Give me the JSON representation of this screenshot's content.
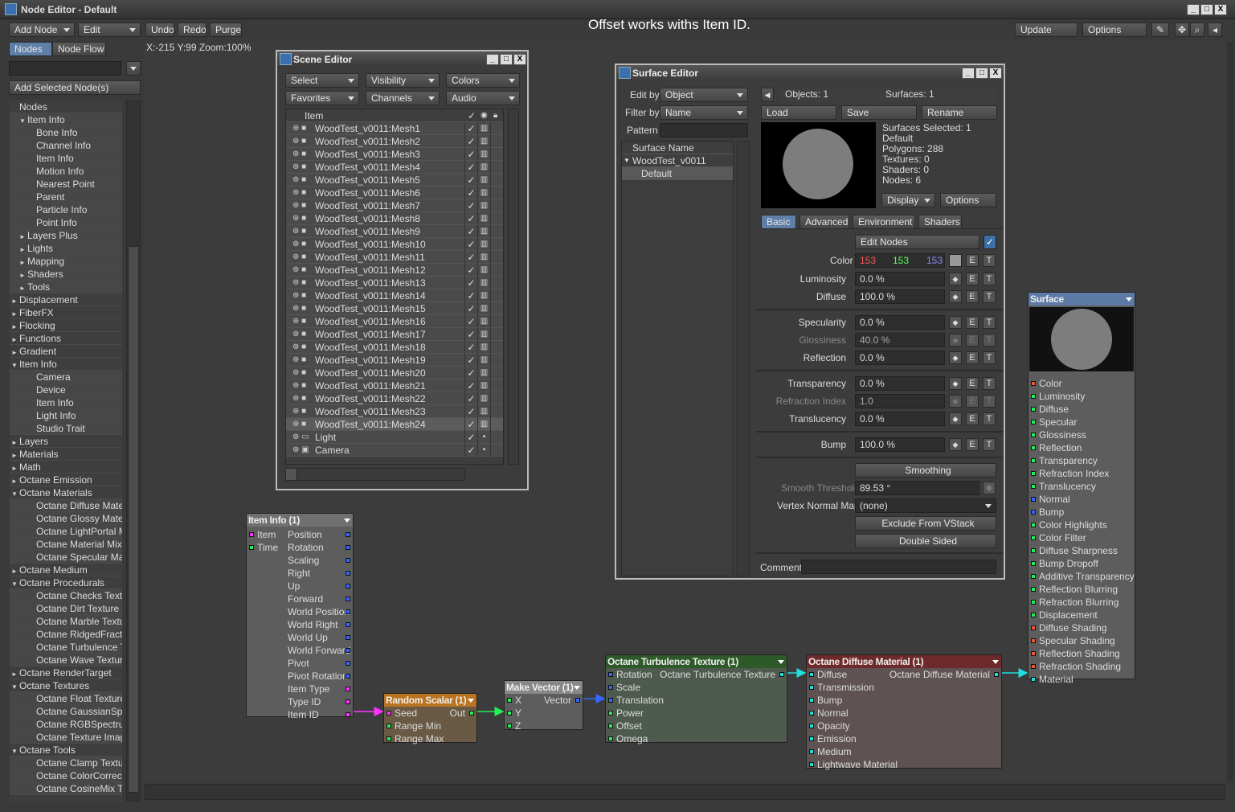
{
  "window": {
    "title": "Node Editor - Default",
    "min": "_",
    "max": "□",
    "close": "X"
  },
  "toolbar": {
    "add_node": "Add Node",
    "edit": "Edit",
    "undo": "Undo",
    "redo": "Redo",
    "purge": "Purge",
    "update": "Update",
    "options": "Options"
  },
  "overlay_text": "Offset works withs Item ID.",
  "tabs": {
    "nodes": "Nodes",
    "node_flow": "Node Flow"
  },
  "add_selected": "Add Selected Node(s)",
  "coords": "X:-215 Y:99 Zoom:100%",
  "sidebar": {
    "items": [
      {
        "label": "Nodes",
        "level": 0,
        "arrow": ""
      },
      {
        "label": "Item Info",
        "level": 1,
        "arrow": "▼"
      },
      {
        "label": "Bone Info",
        "level": 2,
        "arrow": ""
      },
      {
        "label": "Channel Info",
        "level": 2,
        "arrow": ""
      },
      {
        "label": "Item Info",
        "level": 2,
        "arrow": ""
      },
      {
        "label": "Motion Info",
        "level": 2,
        "arrow": ""
      },
      {
        "label": "Nearest Point",
        "level": 2,
        "arrow": ""
      },
      {
        "label": "Parent",
        "level": 2,
        "arrow": ""
      },
      {
        "label": "Particle Info",
        "level": 2,
        "arrow": ""
      },
      {
        "label": "Point Info",
        "level": 2,
        "arrow": ""
      },
      {
        "label": "Layers Plus",
        "level": 1,
        "arrow": "►"
      },
      {
        "label": "Lights",
        "level": 1,
        "arrow": "►"
      },
      {
        "label": "Mapping",
        "level": 1,
        "arrow": "►"
      },
      {
        "label": "Shaders",
        "level": 1,
        "arrow": "►"
      },
      {
        "label": "Tools",
        "level": 1,
        "arrow": "►"
      },
      {
        "label": "Displacement",
        "level": 0,
        "arrow": "►"
      },
      {
        "label": "FiberFX",
        "level": 0,
        "arrow": "►"
      },
      {
        "label": "Flocking",
        "level": 0,
        "arrow": "►"
      },
      {
        "label": "Functions",
        "level": 0,
        "arrow": "►"
      },
      {
        "label": "Gradient",
        "level": 0,
        "arrow": "►"
      },
      {
        "label": "Item Info",
        "level": 0,
        "arrow": "▼"
      },
      {
        "label": "Camera",
        "level": 2,
        "arrow": ""
      },
      {
        "label": "Device",
        "level": 2,
        "arrow": ""
      },
      {
        "label": "Item Info",
        "level": 2,
        "arrow": ""
      },
      {
        "label": "Light Info",
        "level": 2,
        "arrow": ""
      },
      {
        "label": "Studio Trait",
        "level": 2,
        "arrow": ""
      },
      {
        "label": "Layers",
        "level": 0,
        "arrow": "►"
      },
      {
        "label": "Materials",
        "level": 0,
        "arrow": "►"
      },
      {
        "label": "Math",
        "level": 0,
        "arrow": "►"
      },
      {
        "label": "Octane Emission",
        "level": 0,
        "arrow": "►"
      },
      {
        "label": "Octane Materials",
        "level": 0,
        "arrow": "▼"
      },
      {
        "label": "Octane Diffuse Material",
        "level": 2,
        "arrow": ""
      },
      {
        "label": "Octane Glossy Material",
        "level": 2,
        "arrow": ""
      },
      {
        "label": "Octane LightPortal Mate",
        "level": 2,
        "arrow": ""
      },
      {
        "label": "Octane Material Mixer",
        "level": 2,
        "arrow": ""
      },
      {
        "label": "Octane Specular Materia",
        "level": 2,
        "arrow": ""
      },
      {
        "label": "Octane Medium",
        "level": 0,
        "arrow": "►"
      },
      {
        "label": "Octane Procedurals",
        "level": 0,
        "arrow": "▼"
      },
      {
        "label": "Octane Checks Texture",
        "level": 2,
        "arrow": ""
      },
      {
        "label": "Octane Dirt Texture",
        "level": 2,
        "arrow": ""
      },
      {
        "label": "Octane Marble Texture",
        "level": 2,
        "arrow": ""
      },
      {
        "label": "Octane RidgedFractal Te",
        "level": 2,
        "arrow": ""
      },
      {
        "label": "Octane Turbulence Text",
        "level": 2,
        "arrow": ""
      },
      {
        "label": "Octane Wave Texture",
        "level": 2,
        "arrow": ""
      },
      {
        "label": "Octane RenderTarget",
        "level": 0,
        "arrow": "►"
      },
      {
        "label": "Octane Textures",
        "level": 0,
        "arrow": "▼"
      },
      {
        "label": "Octane Float Texture",
        "level": 2,
        "arrow": ""
      },
      {
        "label": "Octane GaussianSpectru",
        "level": 2,
        "arrow": ""
      },
      {
        "label": "Octane RGBSpectrum T",
        "level": 2,
        "arrow": ""
      },
      {
        "label": "Octane Texture Image",
        "level": 2,
        "arrow": ""
      },
      {
        "label": "Octane Tools",
        "level": 0,
        "arrow": "▼"
      },
      {
        "label": "Octane Clamp Texture",
        "level": 2,
        "arrow": ""
      },
      {
        "label": "Octane ColorCorrect Tex",
        "level": 2,
        "arrow": ""
      },
      {
        "label": "Octane CosineMix Textu",
        "level": 2,
        "arrow": ""
      }
    ]
  },
  "scene_editor": {
    "title": "Scene Editor",
    "select": "Select",
    "visibility": "Visibility",
    "colors": "Colors",
    "favorites": "Favorites",
    "channels": "Channels",
    "audio": "Audio",
    "col_item": "Item",
    "items": [
      "WoodTest_v0011:Mesh1",
      "WoodTest_v0011:Mesh2",
      "WoodTest_v0011:Mesh3",
      "WoodTest_v0011:Mesh4",
      "WoodTest_v0011:Mesh5",
      "WoodTest_v0011:Mesh6",
      "WoodTest_v0011:Mesh7",
      "WoodTest_v0011:Mesh8",
      "WoodTest_v0011:Mesh9",
      "WoodTest_v0011:Mesh10",
      "WoodTest_v0011:Mesh11",
      "WoodTest_v0011:Mesh12",
      "WoodTest_v0011:Mesh13",
      "WoodTest_v0011:Mesh14",
      "WoodTest_v0011:Mesh15",
      "WoodTest_v0011:Mesh16",
      "WoodTest_v0011:Mesh17",
      "WoodTest_v0011:Mesh18",
      "WoodTest_v0011:Mesh19",
      "WoodTest_v0011:Mesh20",
      "WoodTest_v0011:Mesh21",
      "WoodTest_v0011:Mesh22",
      "WoodTest_v0011:Mesh23",
      "WoodTest_v0011:Mesh24",
      "Light",
      "Camera"
    ]
  },
  "surface_editor": {
    "title": "Surface Editor",
    "edit_by_label": "Edit by",
    "edit_by": "Object",
    "filter_by_label": "Filter by",
    "filter_by": "Name",
    "pattern_label": "Pattern",
    "objects": "Objects: 1",
    "surfaces": "Surfaces: 1",
    "load": "Load",
    "save": "Save",
    "rename": "Rename",
    "col_surface": "Surface Name",
    "tree_obj": "WoodTest_v0011",
    "tree_surf": "Default",
    "info": [
      "Surfaces Selected: 1",
      "Default",
      "Polygons: 288",
      "Textures: 0",
      "Shaders: 0",
      "Nodes: 6"
    ],
    "display": "Display",
    "options": "Options",
    "tabs": [
      "Basic",
      "Advanced",
      "Environment",
      "Shaders"
    ],
    "edit_nodes": "Edit Nodes",
    "color_label": "Color",
    "color_r": "153",
    "color_g": "153",
    "color_b": "153",
    "props": [
      {
        "label": "Luminosity",
        "value": "0.0 %"
      },
      {
        "label": "Diffuse",
        "value": "100.0 %"
      },
      {
        "label": "Specularity",
        "value": "0.0 %"
      },
      {
        "label": "Glossiness",
        "value": "40.0 %"
      },
      {
        "label": "Reflection",
        "value": "0.0 %"
      },
      {
        "label": "Transparency",
        "value": "0.0 %"
      },
      {
        "label": "Refraction Index",
        "value": "1.0"
      },
      {
        "label": "Translucency",
        "value": "0.0 %"
      },
      {
        "label": "Bump",
        "value": "100.0 %"
      }
    ],
    "smoothing": "Smoothing",
    "smooth_threshold_label": "Smooth Threshold",
    "smooth_threshold": "89.53 °",
    "vertex_normal_label": "Vertex Normal Map",
    "vertex_normal": "(none)",
    "exclude": "Exclude From VStack",
    "double_sided": "Double Sided",
    "comment_label": "Comment",
    "e": "E",
    "t": "T"
  },
  "nodes": {
    "item_info": {
      "title": "Item Info (1)",
      "inputs": [
        "Item",
        "Time"
      ],
      "outputs": [
        "Position",
        "Rotation",
        "Scaling",
        "Right",
        "Up",
        "Forward",
        "World Position",
        "World Right",
        "World Up",
        "World Forward",
        "Pivot",
        "Pivot Rotation",
        "Item Type",
        "Type ID",
        "Item ID"
      ]
    },
    "random_scalar": {
      "title": "Random Scalar (1)",
      "inputs": [
        "Seed",
        "Range Min",
        "Range Max"
      ],
      "output": "Out"
    },
    "make_vector": {
      "title": "Make Vector (1)",
      "inputs": [
        "X",
        "Y",
        "Z"
      ],
      "output": "Vector"
    },
    "turbulence": {
      "title": "Octane Turbulence Texture (1)",
      "inputs": [
        "Rotation",
        "Scale",
        "Translation",
        "Power",
        "Offset",
        "Omega"
      ],
      "output": "Octane Turbulence Texture"
    },
    "diffuse": {
      "title": "Octane Diffuse Material (1)",
      "inputs": [
        "Diffuse",
        "Transmission",
        "Bump",
        "Normal",
        "Opacity",
        "Emission",
        "Medium",
        "Lightwave Material"
      ],
      "output": "Octane Diffuse Material"
    },
    "surface": {
      "title": "Surface",
      "inputs": [
        "Color",
        "Luminosity",
        "Diffuse",
        "Specular",
        "Glossiness",
        "Reflection",
        "Transparency",
        "Refraction Index",
        "Translucency",
        "Normal",
        "Bump",
        "Color Highlights",
        "Color Filter",
        "Diffuse Sharpness",
        "Bump Dropoff",
        "Additive Transparency",
        "Reflection Blurring",
        "Refraction Blurring",
        "Displacement",
        "Diffuse Shading",
        "Specular Shading",
        "Reflection Shading",
        "Refraction Shading",
        "Material"
      ]
    }
  }
}
